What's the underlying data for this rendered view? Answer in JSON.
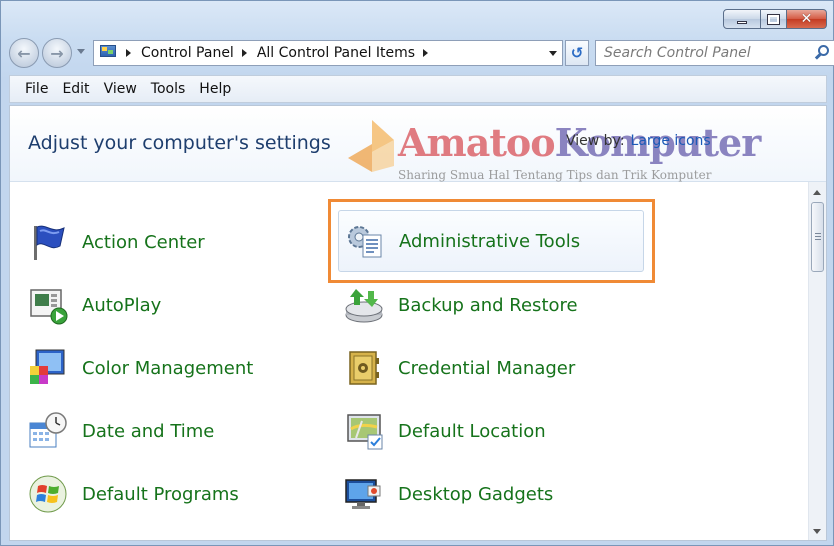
{
  "window": {
    "minimize_glyph": "—",
    "maximize_glyph": "▢",
    "close_glyph": "✕"
  },
  "nav": {
    "back_glyph": "←",
    "forward_glyph": "→",
    "breadcrumbs": [
      "Control Panel",
      "All Control Panel Items"
    ],
    "refresh_glyph": "↺",
    "search_placeholder": "Search Control Panel"
  },
  "menu": [
    "File",
    "Edit",
    "View",
    "Tools",
    "Help"
  ],
  "header": {
    "title": "Adjust your computer's settings",
    "view_by_label": "View by:",
    "view_by_value": "Large icons"
  },
  "watermark": {
    "brand_a": "Amatoo",
    "brand_b": "Komputer",
    "tagline": "Sharing Smua Hal Tentang Tips dan Trik Komputer"
  },
  "items": [
    {
      "label": "Action Center",
      "icon": "flag-icon"
    },
    {
      "label": "Administrative Tools",
      "icon": "admin-tools-icon"
    },
    {
      "label": "AutoPlay",
      "icon": "autoplay-icon"
    },
    {
      "label": "Backup and Restore",
      "icon": "backup-icon"
    },
    {
      "label": "Color Management",
      "icon": "color-management-icon"
    },
    {
      "label": "Credential Manager",
      "icon": "safe-icon"
    },
    {
      "label": "Date and Time",
      "icon": "calendar-clock-icon"
    },
    {
      "label": "Default Location",
      "icon": "location-icon"
    },
    {
      "label": "Default Programs",
      "icon": "windows-orb-icon"
    },
    {
      "label": "Desktop Gadgets",
      "icon": "gadgets-icon"
    }
  ],
  "colors": {
    "link_green": "#16731b",
    "title_blue": "#1e3e6e",
    "highlight_orange": "#f08a35"
  }
}
